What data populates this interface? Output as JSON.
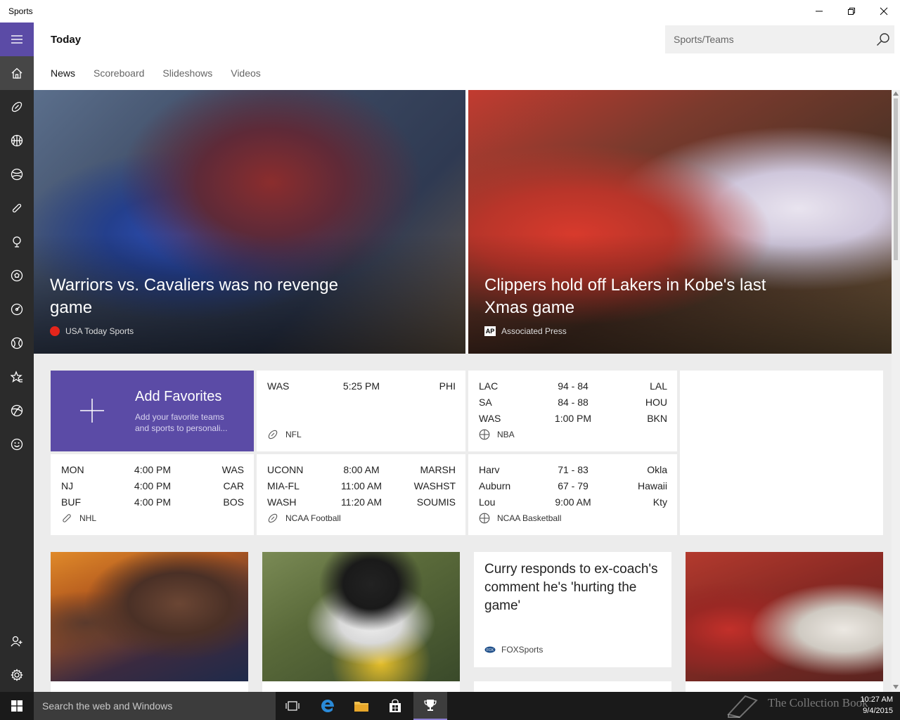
{
  "window": {
    "title": "Sports"
  },
  "header": {
    "page_title": "Today",
    "search_placeholder": "Sports/Teams",
    "tabs": [
      {
        "label": "News",
        "active": true
      },
      {
        "label": "Scoreboard",
        "active": false
      },
      {
        "label": "Slideshows",
        "active": false
      },
      {
        "label": "Videos",
        "active": false
      }
    ]
  },
  "rail": {
    "icons": [
      "hamburger-menu-icon",
      "home-icon",
      "football-icon",
      "basketball-icon",
      "baseball-icon",
      "hockey-icon",
      "golf-icon",
      "soccer-icon",
      "tennis-icon",
      "racing-icon",
      "favorites-icon",
      "multisport-icon",
      "emoji-icon",
      "add-user-icon",
      "settings-icon"
    ]
  },
  "hero": [
    {
      "headline": "Warriors vs. Cavaliers was no revenge game",
      "source": "USA Today Sports",
      "source_color": "#e4251b"
    },
    {
      "headline": "Clippers hold off Lakers in Kobe's last Xmas game",
      "source": "Associated Press"
    }
  ],
  "favorites": {
    "title": "Add Favorites",
    "subtitle": "Add your favorite teams and sports to personali..."
  },
  "scoreboards": {
    "nfl": {
      "league": "NFL",
      "rows": [
        {
          "a": "WAS",
          "m": "5:25 PM",
          "b": "PHI"
        }
      ]
    },
    "nba": {
      "league": "NBA",
      "rows": [
        {
          "a": "LAC",
          "m": "94  -  84",
          "b": "LAL"
        },
        {
          "a": "SA",
          "m": "84  -  88",
          "b": "HOU"
        },
        {
          "a": "WAS",
          "m": "1:00 PM",
          "b": "BKN"
        }
      ]
    },
    "nhl": {
      "league": "NHL",
      "rows": [
        {
          "a": "MON",
          "m": "4:00 PM",
          "b": "WAS"
        },
        {
          "a": "NJ",
          "m": "4:00 PM",
          "b": "CAR"
        },
        {
          "a": "BUF",
          "m": "4:00 PM",
          "b": "BOS"
        }
      ]
    },
    "ncaaf": {
      "league": "NCAA Football",
      "rows": [
        {
          "a": "UCONN",
          "m": "8:00 AM",
          "b": "MARSH"
        },
        {
          "a": "MIA-FL",
          "m": "11:00 AM",
          "b": "WASHST"
        },
        {
          "a": "WASH",
          "m": "11:20 AM",
          "b": "SOUMIS"
        }
      ]
    },
    "ncaab": {
      "league": "NCAA Basketball",
      "rows": [
        {
          "a": "Harv",
          "m": "71  -  83",
          "b": "Okla"
        },
        {
          "a": "Auburn",
          "m": "67  -  79",
          "b": "Hawaii"
        },
        {
          "a": "Lou",
          "m": "9:00 AM",
          "b": "Kty"
        }
      ]
    }
  },
  "news": {
    "text_card": {
      "title": "Curry responds to ex-coach's comment he's 'hurting the game'",
      "source": "FOXSports"
    }
  },
  "taskbar": {
    "search_text": "Search the web and Windows",
    "time": "10:27 AM",
    "date": "9/4/2015",
    "watermark": "The Collection Book"
  },
  "colors": {
    "accent": "#5b4ba6",
    "rail": "#2b2b2b",
    "taskbar": "#1a1a1a"
  }
}
